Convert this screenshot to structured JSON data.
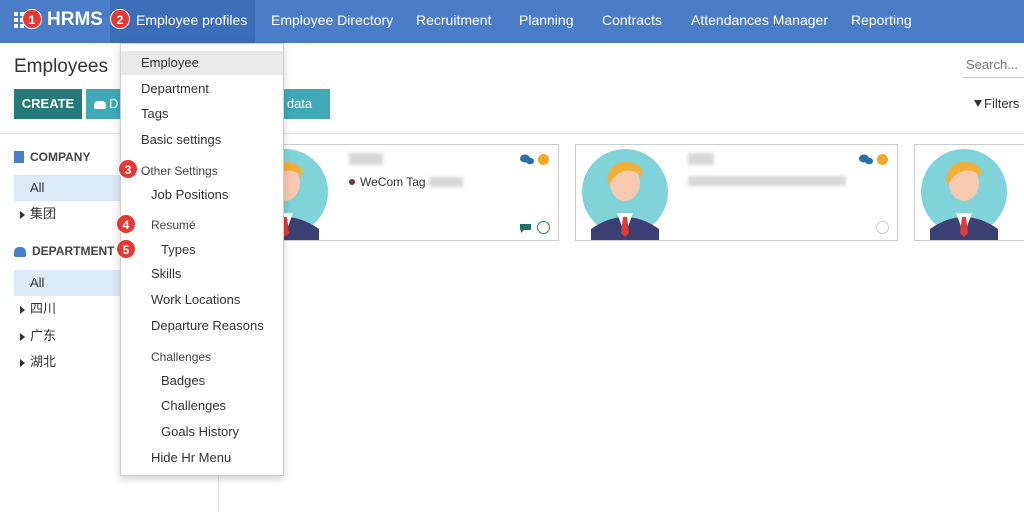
{
  "app": {
    "name": "HRMS"
  },
  "navbar": {
    "items": [
      {
        "label": "Employee profiles",
        "active": true
      },
      {
        "label": "Employee Directory"
      },
      {
        "label": "Recruitment"
      },
      {
        "label": "Planning"
      },
      {
        "label": "Contracts"
      },
      {
        "label": "Attendances Manager"
      },
      {
        "label": "Reporting"
      }
    ],
    "color": "#4a7cc7"
  },
  "markers": [
    "1",
    "2",
    "3",
    "4",
    "5"
  ],
  "page": {
    "title": "Employees",
    "create_label": "CREATE",
    "download_label": "D",
    "import_label": "e data",
    "search_placeholder": "Search...",
    "filters_label": "Filters"
  },
  "left_panel": {
    "company": {
      "heading": "COMPANY",
      "items": [
        "All",
        "集团"
      ]
    },
    "department": {
      "heading": "DEPARTMENT",
      "items": [
        "All",
        "四川",
        "广东",
        "湖北"
      ]
    }
  },
  "menu": {
    "items": [
      {
        "label": "Employee",
        "highlighted": true
      },
      {
        "label": "Department"
      },
      {
        "label": "Tags"
      },
      {
        "label": "Basic settings"
      },
      {
        "label": "Other Settings",
        "header": true
      },
      {
        "label": "Job Positions"
      },
      {
        "label": "Resumé",
        "header": true
      },
      {
        "label": "Types"
      },
      {
        "label": "Skills"
      },
      {
        "label": "Work Locations"
      },
      {
        "label": "Departure Reasons"
      },
      {
        "label": "Challenges",
        "header": true
      },
      {
        "label": "Badges"
      },
      {
        "label": "Challenges"
      },
      {
        "label": "Goals History"
      },
      {
        "label": "Hide Hr Menu"
      }
    ]
  },
  "cards": [
    {
      "tag": "WeCom Tag"
    }
  ],
  "colors": {
    "create": "#267a7a",
    "secondary": "#3fa9b8",
    "badge": "#e53935",
    "status": "#f5a623"
  }
}
